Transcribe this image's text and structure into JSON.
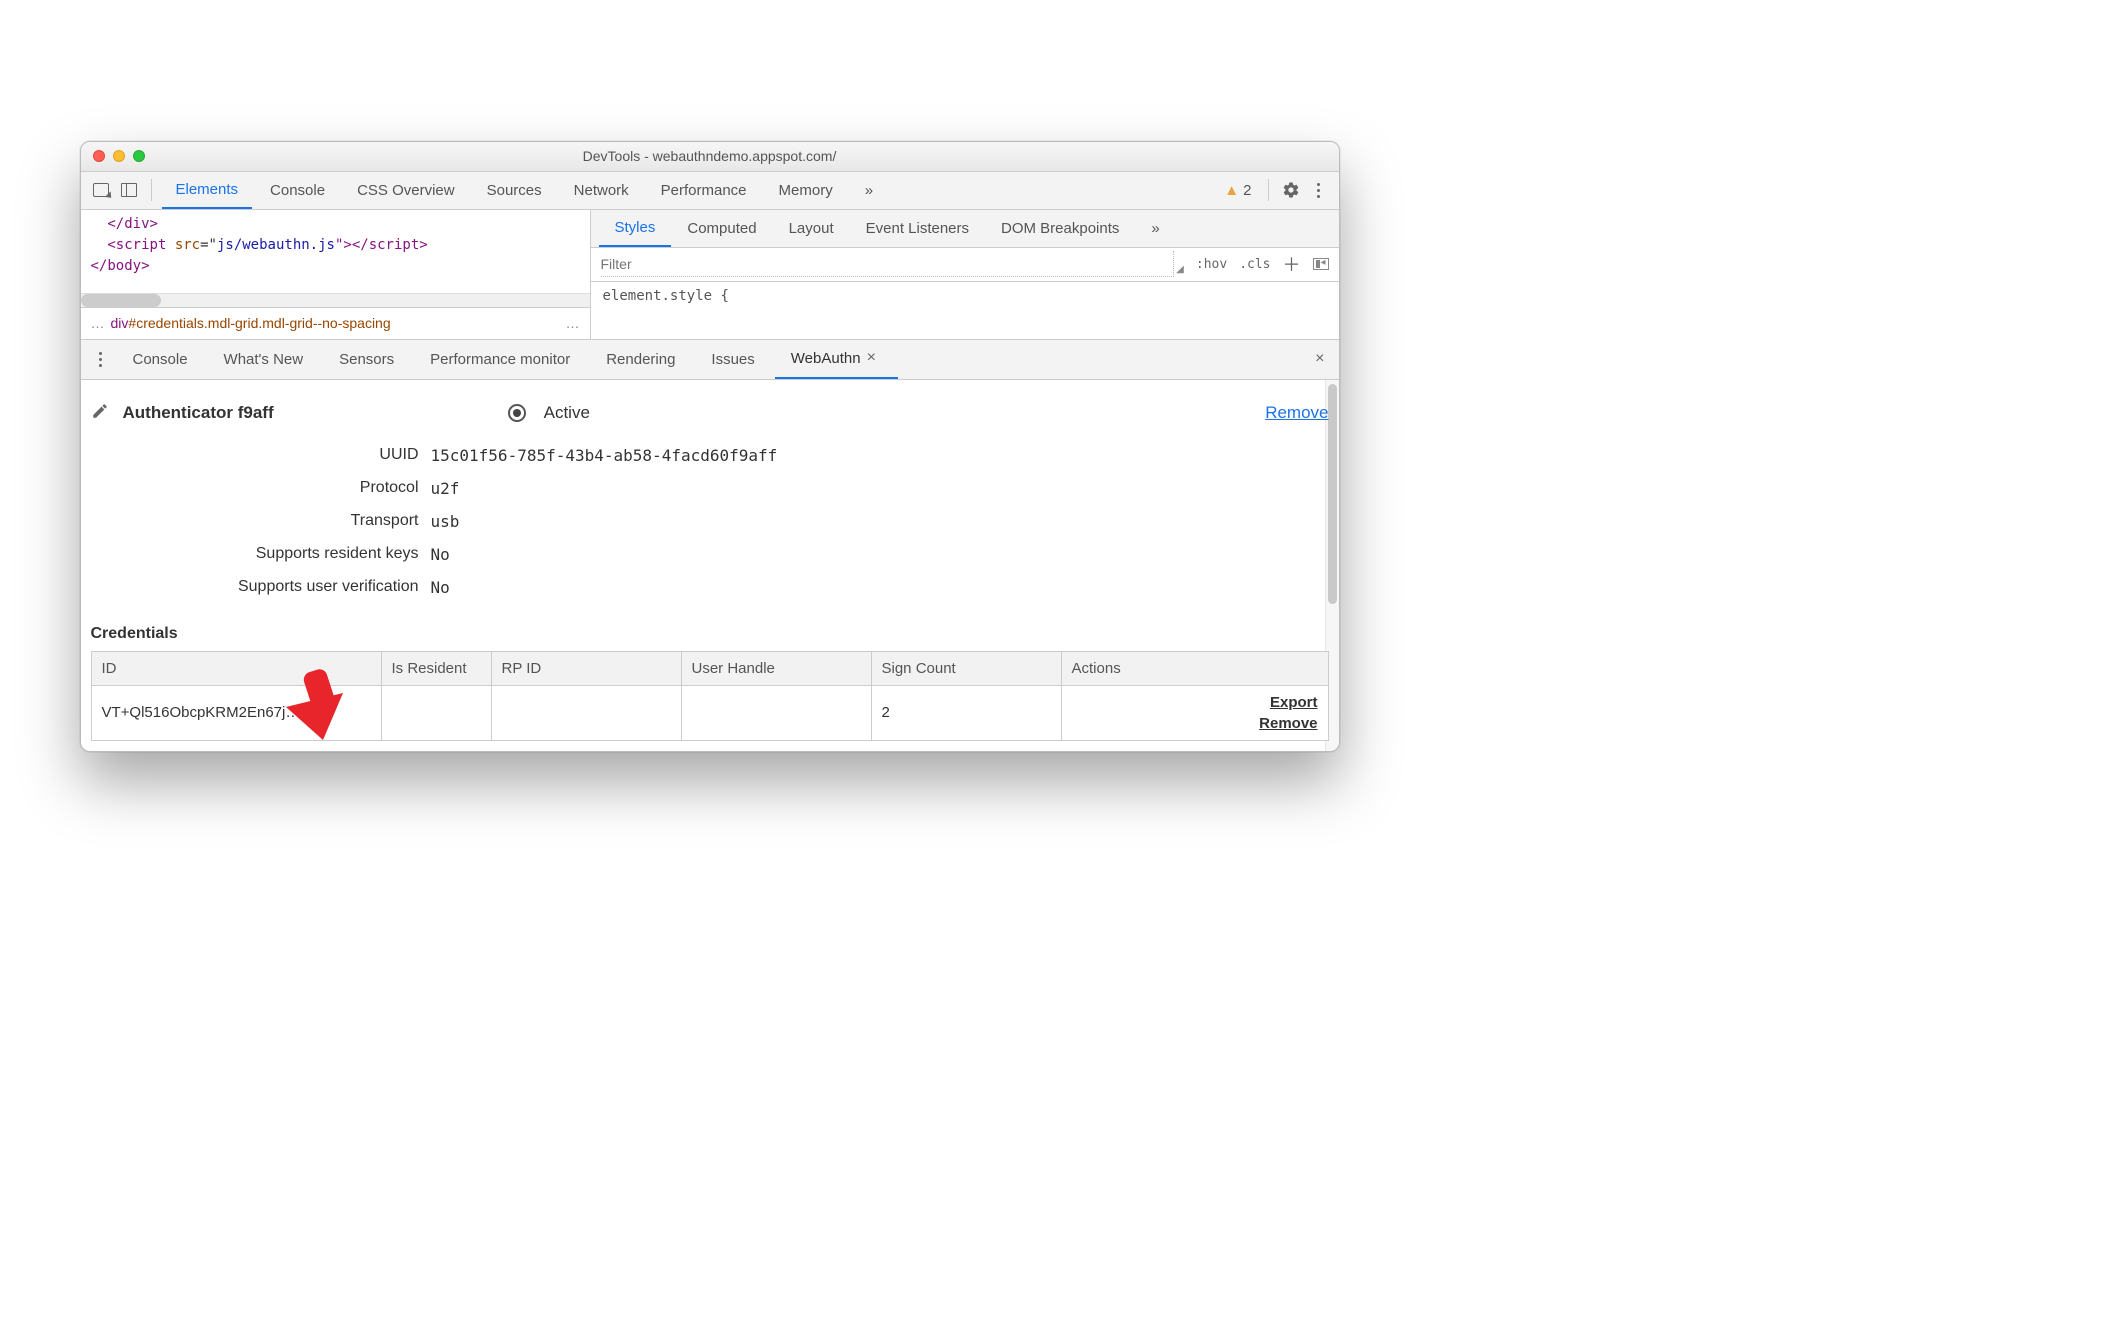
{
  "titlebar": {
    "title": "DevTools - webauthndemo.appspot.com/"
  },
  "mainTabs": {
    "items": [
      "Elements",
      "Console",
      "CSS Overview",
      "Sources",
      "Network",
      "Performance",
      "Memory"
    ],
    "overflow": "»",
    "warnCount": "2"
  },
  "elementsPane": {
    "code_line1a": "</",
    "code_line1b": "div",
    "code_line1c": ">",
    "code_line2a": "<",
    "code_line2b": "script ",
    "code_line2c": "src",
    "code_line2d": "=\"",
    "code_line2e": "js/webauthn.js",
    "code_line2f": "\"></",
    "code_line2g": "script",
    "code_line2h": ">",
    "code_line3a": "</",
    "code_line3b": "body",
    "code_line3c": ">",
    "breadcrumb_pre": "…",
    "breadcrumb_tag": "div",
    "breadcrumb_id": "#credentials",
    "breadcrumb_cls": ".mdl-grid.mdl-grid--no-spacing",
    "breadcrumb_post": "…"
  },
  "stylesPane": {
    "tabs": [
      "Styles",
      "Computed",
      "Layout",
      "Event Listeners",
      "DOM Breakpoints"
    ],
    "overflow": "»",
    "filter_placeholder": "Filter",
    "hov": ":hov",
    "cls": ".cls",
    "element_style": "element.style {"
  },
  "drawer": {
    "tabs": [
      "Console",
      "What's New",
      "Sensors",
      "Performance monitor",
      "Rendering",
      "Issues",
      "WebAuthn"
    ],
    "activeIndex": 6
  },
  "webauthn": {
    "title": "Authenticator f9aff",
    "active": "Active",
    "remove": "Remove",
    "props": {
      "uuid_label": "UUID",
      "uuid": "15c01f56-785f-43b4-ab58-4facd60f9aff",
      "protocol_label": "Protocol",
      "protocol": "u2f",
      "transport_label": "Transport",
      "transport": "usb",
      "resident_label": "Supports resident keys",
      "resident": "No",
      "uv_label": "Supports user verification",
      "uv": "No"
    },
    "credentials_title": "Credentials",
    "table": {
      "headers": [
        "ID",
        "Is Resident",
        "RP ID",
        "User Handle",
        "Sign Count",
        "Actions"
      ],
      "row": {
        "id": "VT+Ql516ObcpKRM2En67j…",
        "is_resident": "",
        "rp_id": "",
        "user_handle": "",
        "sign_count": "2",
        "export": "Export",
        "remove": "Remove"
      }
    }
  }
}
